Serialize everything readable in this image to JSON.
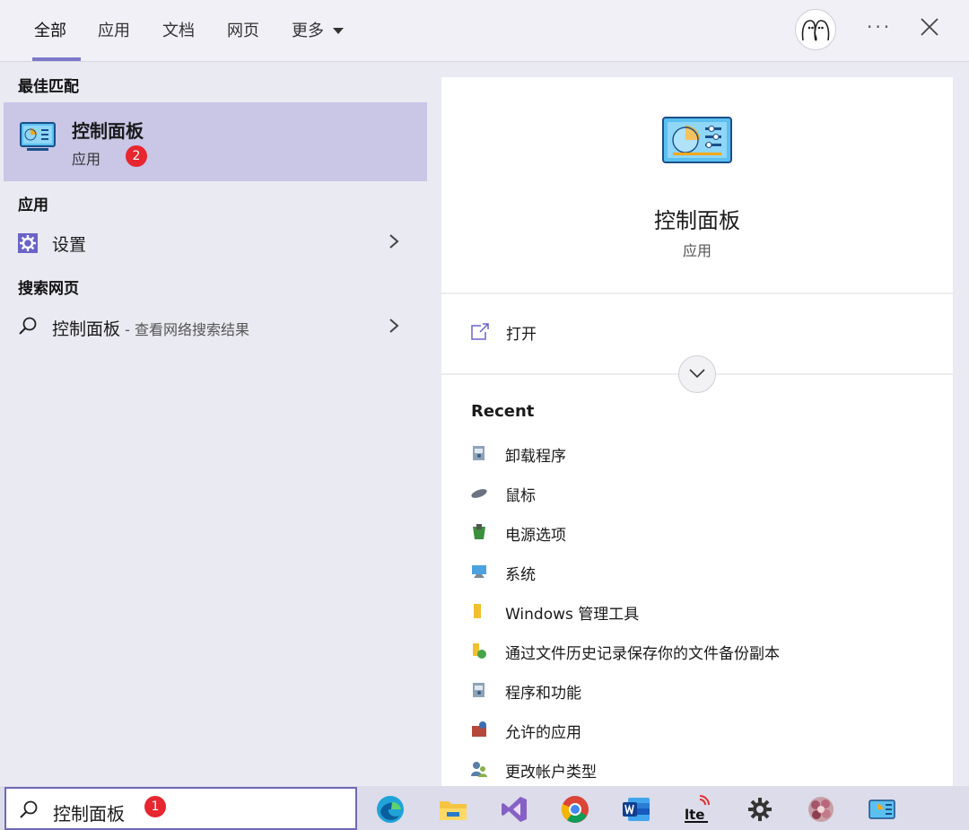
{
  "tabs": [
    {
      "label": "全部",
      "active": true
    },
    {
      "label": "应用"
    },
    {
      "label": "文档"
    },
    {
      "label": "网页"
    },
    {
      "label": "更多"
    }
  ],
  "header": {
    "more_icon": "ellipsis-icon",
    "close_icon": "close-icon",
    "avatar_icon": "avatar-icon"
  },
  "best_match": {
    "section": "最佳匹配",
    "title": "控制面板",
    "subtitle": "应用",
    "badge": "2"
  },
  "apps": {
    "section": "应用",
    "items": [
      {
        "label": "设置"
      }
    ]
  },
  "web": {
    "section": "搜索网页",
    "query": "控制面板",
    "hint": " - 查看网络搜索结果"
  },
  "detail": {
    "title": "控制面板",
    "subtitle": "应用",
    "open_label": "打开",
    "recent_heading": "Recent",
    "recent_items": [
      {
        "label": "卸载程序"
      },
      {
        "label": "鼠标"
      },
      {
        "label": "电源选项"
      },
      {
        "label": "系统"
      },
      {
        "label": "Windows 管理工具"
      },
      {
        "label": "通过文件历史记录保存你的文件备份副本"
      },
      {
        "label": "程序和功能"
      },
      {
        "label": "允许的应用"
      },
      {
        "label": "更改帐户类型"
      }
    ]
  },
  "search": {
    "query": "控制面板",
    "badge": "1"
  },
  "taskbar": {
    "apps": [
      "edge-icon",
      "file-explorer-icon",
      "visual-studio-icon",
      "chrome-icon",
      "word-icon",
      "lte-icon",
      "settings-gear-icon",
      "flower-photo-icon",
      "control-panel-icon"
    ]
  },
  "colors": {
    "accent": "#7c78c9",
    "selection": "#c9c6e6",
    "badge": "#e8262f"
  }
}
